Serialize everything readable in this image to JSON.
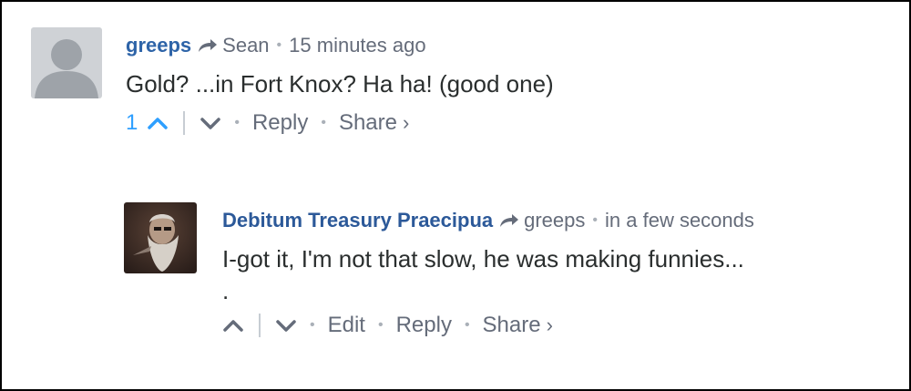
{
  "comments": [
    {
      "author": "greeps",
      "reply_to": "Sean",
      "time": "15 minutes ago",
      "text": "Gold? ...in Fort Knox? Ha ha! (good one)",
      "votes": "1",
      "actions": {
        "reply": "Reply",
        "share": "Share",
        "share_caret": "›"
      }
    },
    {
      "author": "Debitum Treasury Praecipua",
      "reply_to": "greeps",
      "time": "in a few seconds",
      "text": "I-got it, I'm not that slow, he was making funnies...",
      "text_extra": ".",
      "actions": {
        "edit": "Edit",
        "reply": "Reply",
        "share": "Share",
        "share_caret": "›"
      }
    }
  ],
  "separator": "•",
  "colors": {
    "author": "#2e64a8",
    "meta": "#656c7a",
    "upvote_active": "#2e9fff",
    "text": "#2a2e2e"
  },
  "icons": {
    "default_avatar": "generic-person-avatar",
    "user_avatar": "bearded-man-photo-avatar",
    "reply_arrow": "curved-right-arrow-icon",
    "upvote": "chevron-up-icon",
    "downvote": "chevron-down-icon"
  }
}
